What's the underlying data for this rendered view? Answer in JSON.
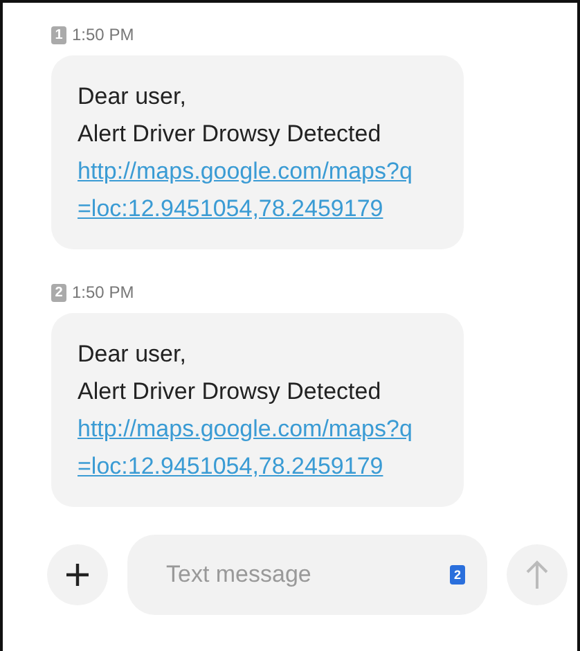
{
  "messages": [
    {
      "sim": "1",
      "time": "1:50 PM",
      "lines": [
        "Dear user,",
        "Alert Driver Drowsy Detected"
      ],
      "link_lines": [
        "http://maps.google.com/maps?q",
        "=loc:12.9451054,78.2459179"
      ]
    },
    {
      "sim": "2",
      "time": "1:50 PM",
      "lines": [
        "Dear user,",
        "Alert Driver Drowsy Detected"
      ],
      "link_lines": [
        "http://maps.google.com/maps?q",
        "=loc:12.9451054,78.2459179"
      ]
    }
  ],
  "composer": {
    "placeholder": "Text message",
    "sim": "2"
  }
}
